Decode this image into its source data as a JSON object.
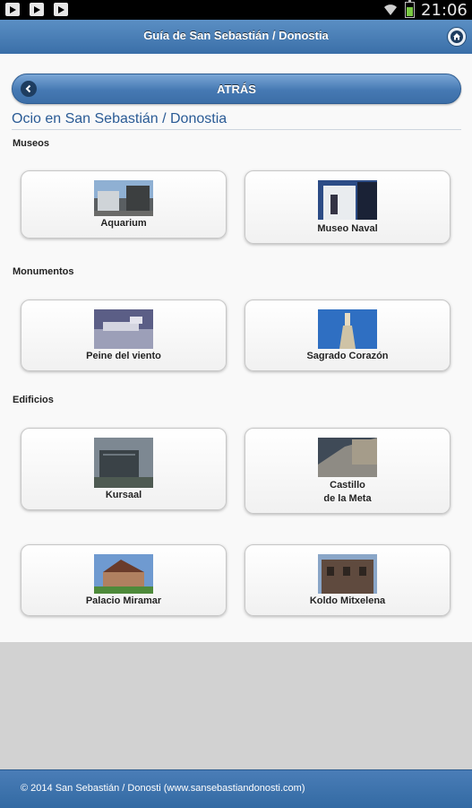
{
  "status_bar": {
    "time": "21:06",
    "battery_color": "#7ac943"
  },
  "header": {
    "title": "Guía de San Sebastián / Donostia",
    "home_icon": "home-icon"
  },
  "back_button": {
    "label": "ATRÁS",
    "icon": "chevron-left-icon"
  },
  "page": {
    "title": "Ocio en San Sebastián / Donostia"
  },
  "sections": [
    {
      "heading": "Museos",
      "items": [
        {
          "label": "Aquarium",
          "thumb": "photo"
        },
        {
          "label": "Museo Naval",
          "thumb": "photo"
        }
      ]
    },
    {
      "heading": "Monumentos",
      "items": [
        {
          "label": "Peine del viento",
          "thumb": "photo"
        },
        {
          "label": "Sagrado Corazón",
          "thumb": "photo"
        }
      ]
    },
    {
      "heading": "Edificios",
      "items": [
        {
          "label": "Kursaal",
          "thumb": "photo"
        },
        {
          "label": "Castillo\nde la Meta",
          "thumb": "photo"
        },
        {
          "label": "Palacio Miramar",
          "thumb": "photo"
        },
        {
          "label": "Koldo Mitxelena",
          "thumb": "photo"
        }
      ]
    }
  ],
  "footer": {
    "text": "© 2014 San Sebastián / Donosti (www.sansebastiandonosti.com)"
  },
  "colors": {
    "header": "#3a6fa8",
    "title": "#2a5b95",
    "footer": "#336aa3"
  }
}
